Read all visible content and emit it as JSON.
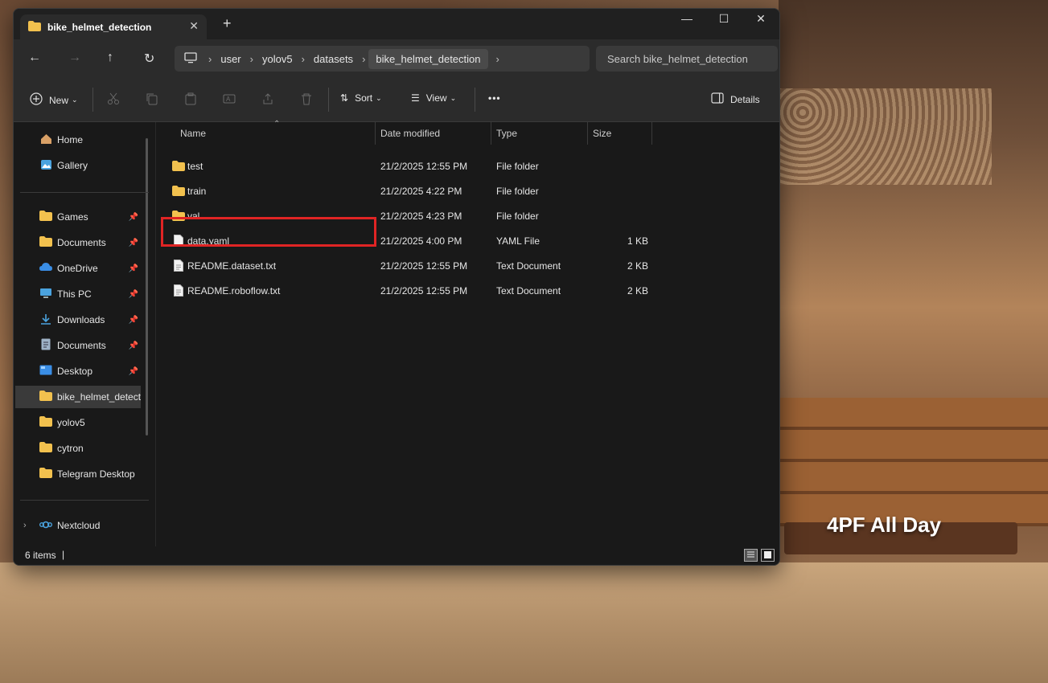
{
  "window": {
    "tab_title": "bike_helmet_detection",
    "newtab_label": "+",
    "minimize": "—",
    "maximize": "☐",
    "close": "✕"
  },
  "nav": {
    "back": "←",
    "forward": "→",
    "up": "↑",
    "refresh": "↻",
    "breadcrumb": [
      "user",
      "yolov5",
      "datasets",
      "bike_helmet_detection"
    ],
    "breadcrumb_sep": "›",
    "search_placeholder": "Search bike_helmet_detection"
  },
  "toolbar": {
    "new_label": "New",
    "sort_label": "Sort",
    "view_label": "View",
    "more_label": "•••",
    "details_label": "Details"
  },
  "sidebar": {
    "items": [
      {
        "label": "Home",
        "icon": "home-icon",
        "pinned": false
      },
      {
        "label": "Gallery",
        "icon": "gallery-icon",
        "pinned": false
      },
      {
        "label": "Games",
        "icon": "folder-icon",
        "pinned": true
      },
      {
        "label": "Documents",
        "icon": "folder-icon",
        "pinned": true
      },
      {
        "label": "OneDrive",
        "icon": "onedrive-icon",
        "pinned": true
      },
      {
        "label": "This PC",
        "icon": "pc-icon",
        "pinned": true
      },
      {
        "label": "Downloads",
        "icon": "download-icon",
        "pinned": true
      },
      {
        "label": "Documents",
        "icon": "document-icon",
        "pinned": true
      },
      {
        "label": "Desktop",
        "icon": "desktop-icon",
        "pinned": true
      },
      {
        "label": "bike_helmet_detection",
        "icon": "folder-icon",
        "pinned": false
      },
      {
        "label": "yolov5",
        "icon": "folder-icon",
        "pinned": false
      },
      {
        "label": "cytron",
        "icon": "folder-icon",
        "pinned": false
      },
      {
        "label": "Telegram Desktop",
        "icon": "folder-icon",
        "pinned": false
      },
      {
        "label": "Nextcloud",
        "icon": "nextcloud-icon",
        "pinned": false
      }
    ]
  },
  "columns": {
    "name": "Name",
    "date": "Date modified",
    "type": "Type",
    "size": "Size"
  },
  "files": [
    {
      "name": "test",
      "date": "21/2/2025 12:55 PM",
      "type": "File folder",
      "size": "",
      "kind": "folder"
    },
    {
      "name": "train",
      "date": "21/2/2025 4:22 PM",
      "type": "File folder",
      "size": "",
      "kind": "folder"
    },
    {
      "name": "val",
      "date": "21/2/2025 4:23 PM",
      "type": "File folder",
      "size": "",
      "kind": "folder"
    },
    {
      "name": "data.yaml",
      "date": "21/2/2025 4:00 PM",
      "type": "YAML File",
      "size": "1 KB",
      "kind": "file"
    },
    {
      "name": "README.dataset.txt",
      "date": "21/2/2025 12:55 PM",
      "type": "Text Document",
      "size": "2 KB",
      "kind": "file"
    },
    {
      "name": "README.roboflow.txt",
      "date": "21/2/2025 12:55 PM",
      "type": "Text Document",
      "size": "2 KB",
      "kind": "file"
    }
  ],
  "status": {
    "item_count": "6 items",
    "cursor": "|"
  },
  "wallpaper": {
    "caption": "4PF All Day"
  },
  "colors": {
    "highlight_box": "#e02424",
    "folder": "#f2c14e",
    "window_bg": "#191919"
  }
}
